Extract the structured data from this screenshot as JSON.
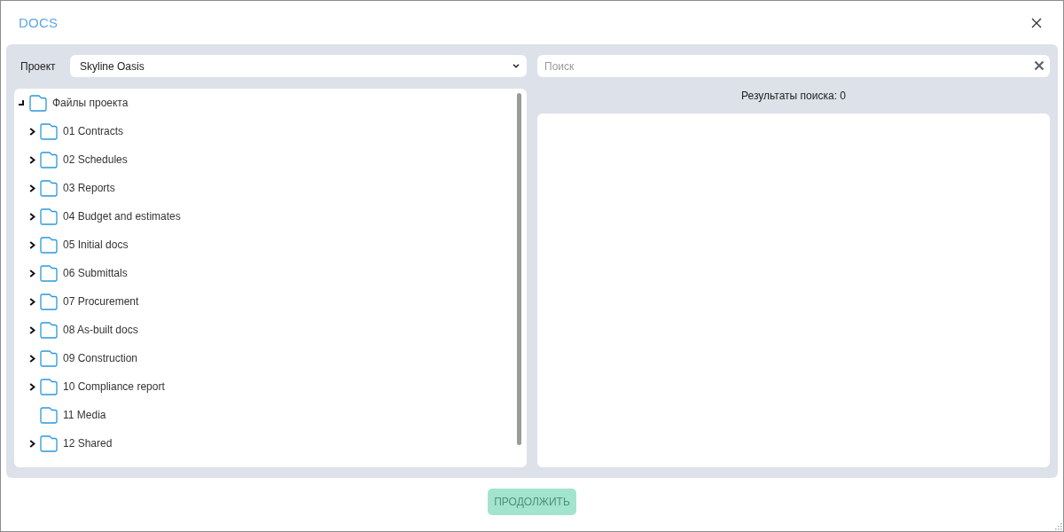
{
  "window": {
    "title": "DOCS"
  },
  "project": {
    "label": "Проект",
    "value": "Skyline Oasis"
  },
  "search": {
    "placeholder": "Поиск"
  },
  "tree": {
    "label": "Файлы проекта",
    "expandable": true,
    "expanded": true,
    "children": [
      {
        "label": "01 Contracts",
        "expandable": true,
        "expanded": false
      },
      {
        "label": "02 Schedules",
        "expandable": true,
        "expanded": false
      },
      {
        "label": "03 Reports",
        "expandable": true,
        "expanded": false
      },
      {
        "label": "04 Budget and estimates",
        "expandable": true,
        "expanded": false
      },
      {
        "label": "05 Initial docs",
        "expandable": true,
        "expanded": false
      },
      {
        "label": "06 Submittals",
        "expandable": true,
        "expanded": false
      },
      {
        "label": "07 Procurement",
        "expandable": true,
        "expanded": false
      },
      {
        "label": "08 As-built docs",
        "expandable": true,
        "expanded": false
      },
      {
        "label": "09 Construction",
        "expandable": true,
        "expanded": false
      },
      {
        "label": "10 Compliance report",
        "expandable": true,
        "expanded": false
      },
      {
        "label": "11 Media",
        "expandable": false,
        "expanded": false
      },
      {
        "label": "12 Shared",
        "expandable": true,
        "expanded": false
      }
    ]
  },
  "results": {
    "summary": "Результаты поиска: 0"
  },
  "buttons": [
    {
      "label": "ПРОДОЛЖИТЬ",
      "disabled": true
    }
  ]
}
